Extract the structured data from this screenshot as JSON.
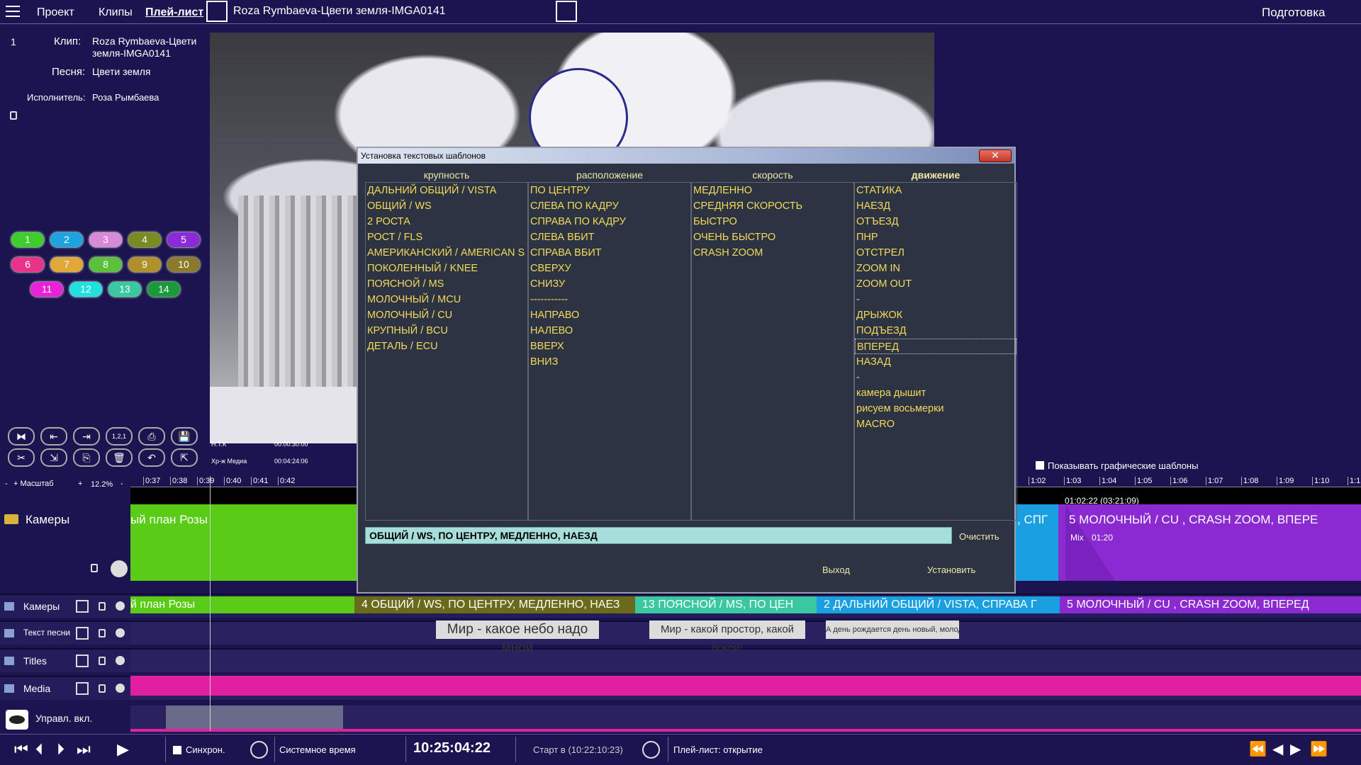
{
  "menu": {
    "project": "Проект",
    "clips": "Клипы",
    "playlist": "Плей-лист",
    "clip_title": "Roza Rymbaeva-Цвети земля-IMGA0141",
    "mode": "Подготовка"
  },
  "clip": {
    "number": "1",
    "clip_label": "Клип:",
    "clip_value": "Roza Rymbaeva-Цвети земля-IMGA0141",
    "song_label": "Песня:",
    "song_value": "Цвети земля",
    "artist_label": "Исполнитель:",
    "artist_value": "Роза Рымбаева"
  },
  "color_buttons": [
    {
      "label": "1",
      "color": "#3fcc2f"
    },
    {
      "label": "2",
      "color": "#1fa3e0"
    },
    {
      "label": "3",
      "color": "#d88ad8"
    },
    {
      "label": "4",
      "color": "#7a8a22"
    },
    {
      "label": "5",
      "color": "#8a2ad8"
    },
    {
      "label": "6",
      "color": "#e8338a"
    },
    {
      "label": "7",
      "color": "#e0a83a"
    },
    {
      "label": "8",
      "color": "#5ac23a"
    },
    {
      "label": "9",
      "color": "#b0902a"
    },
    {
      "label": "10",
      "color": "#8a7a2a"
    },
    {
      "label": "11",
      "color": "#e822d8"
    },
    {
      "label": "12",
      "color": "#22e0e0"
    },
    {
      "label": "13",
      "color": "#3ac8a0"
    },
    {
      "label": "14",
      "color": "#1a9a3a"
    }
  ],
  "tool_buttons": [
    "⧓",
    "⇤",
    "⇥",
    "1,2,1",
    "⎙",
    "💾",
    "✂",
    "⇲",
    "⎘",
    "🗑",
    "↶",
    "⇱"
  ],
  "video_info": {
    "left1": "Н.Т.К",
    "time1": "00:00:30:00",
    "left2": "Хр-ж Медиа",
    "time2": "00:04:24:06"
  },
  "scale": {
    "label": "+ Масштаб",
    "minus": "-",
    "plus": "+",
    "value": "12.2%",
    "minus2": "-"
  },
  "ruler_left": [
    "0:37",
    "0:38",
    "0:39",
    "0:40",
    "0:41",
    "0:42"
  ],
  "ruler_right": [
    "1:02",
    "1:03",
    "1:04",
    "1:05",
    "1:06",
    "1:07",
    "1:08",
    "1:09",
    "1:10",
    "1:1"
  ],
  "timecode_mark": "01:02:22 (03:21:09)",
  "show_templates": "Показывать графические шаблоны",
  "dialog": {
    "title": "Установка текстовых шаблонов",
    "close": "✕",
    "headers": [
      "крупность",
      "расположение",
      "скорость",
      "движение"
    ],
    "col1": [
      "ДАЛЬНИЙ ОБЩИЙ  /  VISTA",
      "ОБЩИЙ  /  WS",
      "2 РОСТА",
      "РОСТ  /  FLS",
      "АМЕРИКАНСКИЙ  /  AMERICAN S",
      "ПОКОЛЕННЫЙ  /  KNEE",
      "ПОЯСНОЙ  /  MS",
      "МОЛОЧНЫЙ  /  MCU",
      "МОЛОЧНЫЙ  /  CU",
      "КРУПНЫЙ  /  BCU",
      "ДЕТАЛЬ  /  ECU"
    ],
    "col2": [
      "ПО ЦЕНТРУ",
      "СЛЕВА ПО КАДРУ",
      "СПРАВА ПО КАДРУ",
      "СЛЕВА ВБИТ",
      "СПРАВА ВБИТ",
      "СВЕРХУ",
      "СНИЗУ",
      "-----------",
      "НАПРАВО",
      "НАЛЕВО",
      "ВВЕРХ",
      "ВНИЗ"
    ],
    "col3": [
      "МЕДЛЕННО",
      "СРЕДНЯЯ СКОРОСТЬ",
      "БЫСТРО",
      "ОЧЕНЬ БЫСТРО",
      "CRASH ZOOM"
    ],
    "col4": [
      "СТАТИКА",
      "НАЕЗД",
      "ОТЪЕЗД",
      "ПНР",
      "ОТСТРЕЛ",
      "ZOOM IN",
      "ZOOM OUT",
      "-",
      "ДРЫЖОК",
      "ПОДЪЕЗД",
      "ВПЕРЕД",
      "НАЗАД",
      "-",
      "камера дышит",
      "рисуем восьмерки",
      "MACRO"
    ],
    "result": "ОБЩИЙ  /  WS, ПО ЦЕНТРУ, МЕДЛЕННО, НАЕЗД",
    "clear": "Очистить",
    "exit": "Выход",
    "apply": "Установить"
  },
  "camera_track": {
    "label": "Камеры",
    "big_left": "ый план Розы",
    "big_right": "5  МОЛОЧНЫЙ  /  CU , CRASH ZOOM, ВПЕРЕ",
    "big_mid": ", СПГ",
    "mix": "Mix",
    "mix_time": "01:20"
  },
  "tracks": [
    {
      "label": "Камеры"
    },
    {
      "label": "Текст песни"
    },
    {
      "label": "Titles"
    },
    {
      "label": "Media"
    }
  ],
  "camera_segments": [
    {
      "text": "й план Розы",
      "color": "#5acc18"
    },
    {
      "text": "4   ОБЩИЙ  /  WS, ПО ЦЕНТРУ, МЕДЛЕННО, НАЕЗ",
      "color": "#6a6a1a"
    },
    {
      "text": "13   ПОЯСНОЙ  /  MS, ПО ЦЕН",
      "color": "#3ac8a0"
    },
    {
      "text": "2  ДАЛЬНИЙ ОБЩИЙ  /  VISTA, СПРАВА Г",
      "color": "#1aa0e0"
    },
    {
      "text": "5   МОЛОЧНЫЙ  /  CU , CRASH ZOOM, ВПЕРЕД",
      "color": "#8a2ad0"
    }
  ],
  "lyrics": [
    "Мир - какое небо надо мной",
    "Мир - какой простор, какой покой!",
    "А день рождается день новый, молодой,"
  ],
  "control_label": "Управл. вкл.",
  "bottom": {
    "sync": "Синхрон.",
    "system_time": "Системное время",
    "clock": "10:25:04:22",
    "start": "Старт в (10:22:10:23)",
    "playlist_status": "Плей-лист: открытие"
  }
}
